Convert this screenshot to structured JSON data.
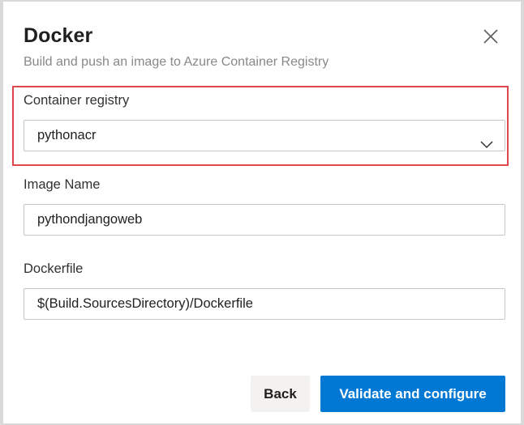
{
  "dialog": {
    "title": "Docker",
    "subtitle": "Build and push an image to Azure Container Registry",
    "close_icon": "close-icon"
  },
  "container_registry": {
    "label": "Container registry",
    "value": "pythonacr",
    "dropdown_icon": "chevron-down-icon"
  },
  "image_name": {
    "label": "Image Name",
    "value": "pythondjangoweb"
  },
  "dockerfile": {
    "label": "Dockerfile",
    "value": "$(Build.SourcesDirectory)/Dockerfile"
  },
  "actions": {
    "back_label": "Back",
    "primary_label": "Validate and configure"
  },
  "colors": {
    "primary": "#0078d4",
    "highlight": "#e0474c"
  }
}
